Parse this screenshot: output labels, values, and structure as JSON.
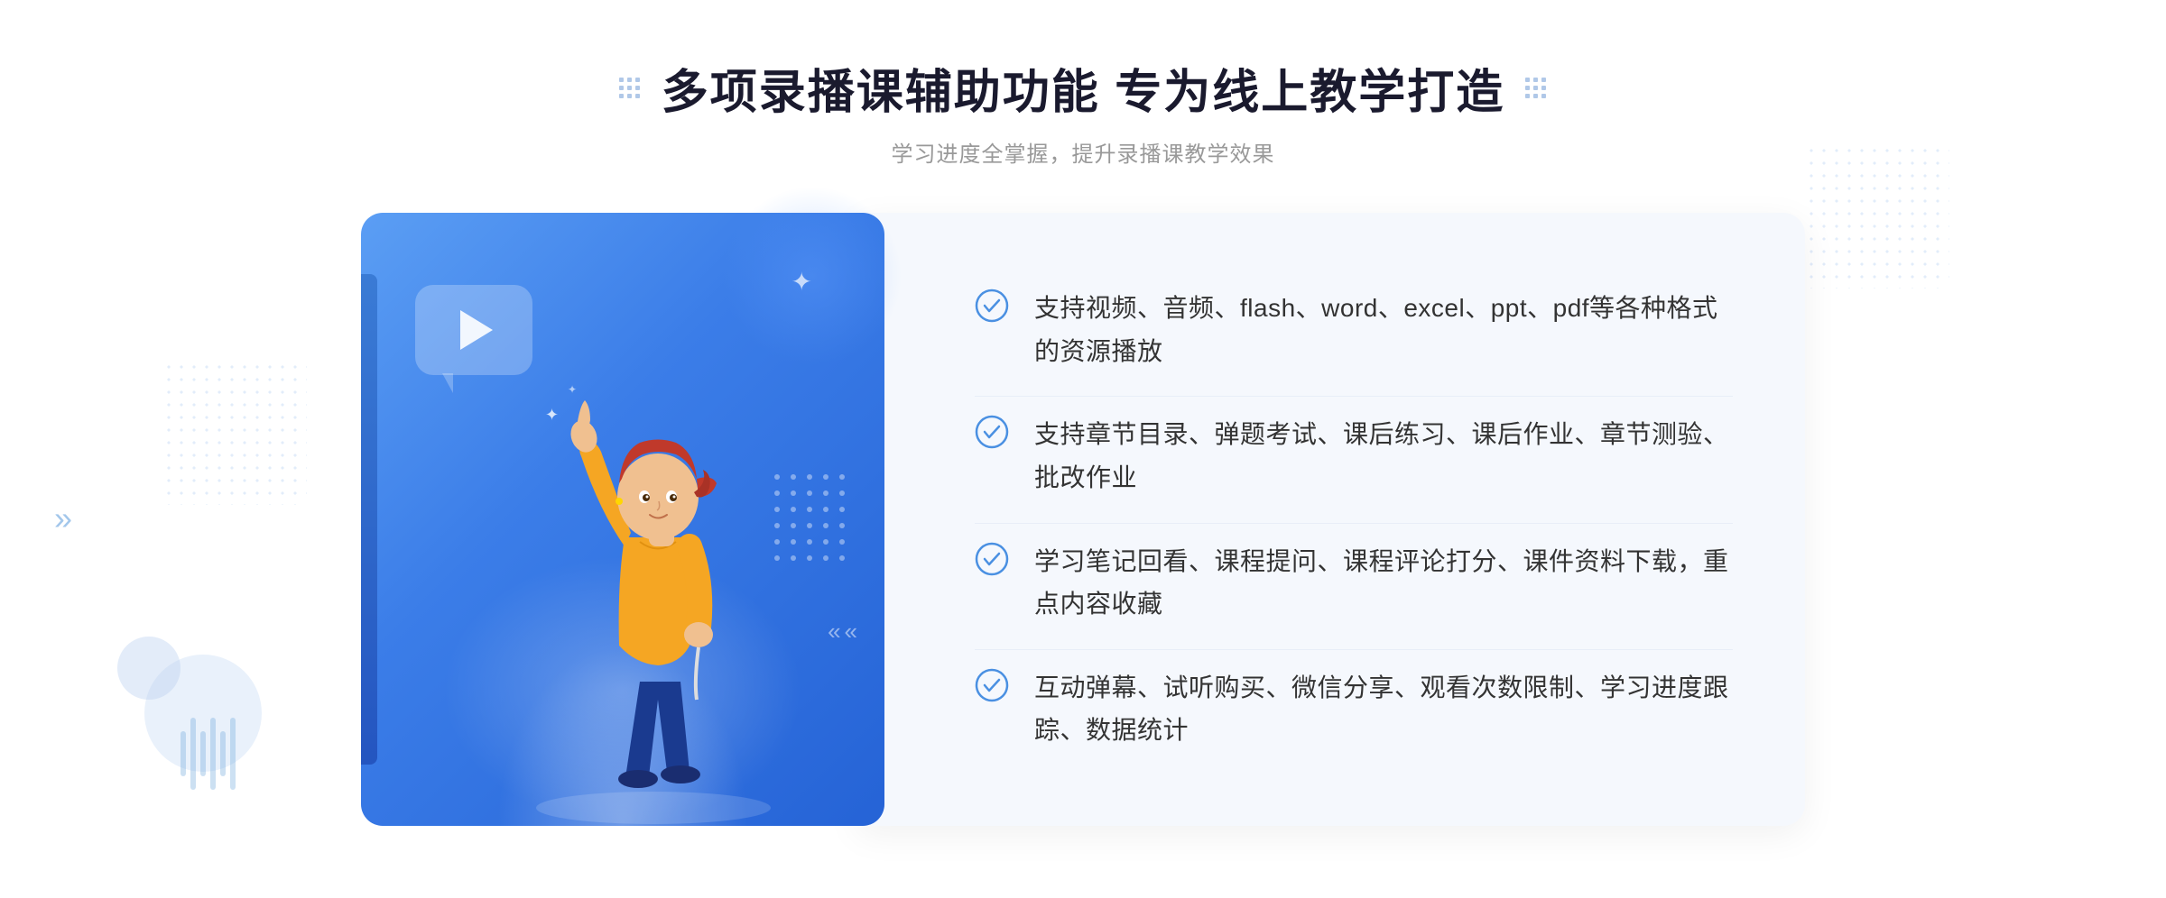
{
  "header": {
    "title": "多项录播课辅助功能 专为线上教学打造",
    "subtitle": "学习进度全掌握，提升录播课教学效果"
  },
  "features": [
    {
      "id": 1,
      "text": "支持视频、音频、flash、word、excel、ppt、pdf等各种格式的资源播放"
    },
    {
      "id": 2,
      "text": "支持章节目录、弹题考试、课后练习、课后作业、章节测验、批改作业"
    },
    {
      "id": 3,
      "text": "学习笔记回看、课程提问、课程评论打分、课件资料下载，重点内容收藏"
    },
    {
      "id": 4,
      "text": "互动弹幕、试听购买、微信分享、观看次数限制、学习进度跟踪、数据统计"
    }
  ],
  "decoration": {
    "chevron_arrows": "»",
    "star": "✦"
  }
}
